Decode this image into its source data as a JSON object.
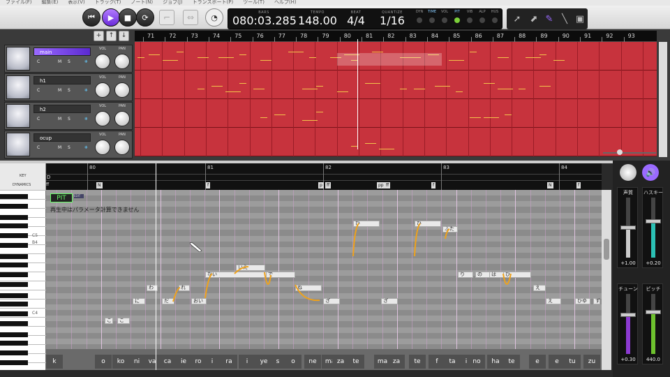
{
  "menu": [
    "ファイル(F)",
    "編集(E)",
    "表示(V)",
    "トラック(T)",
    "ノート(N)",
    "ジョブ(J)",
    "トランスポート(P)",
    "ツール(T)",
    "ヘルプ(H)"
  ],
  "transport": {
    "bars_label": "BARS",
    "bars_value": "080:03.285",
    "tempo_label": "TEMPO",
    "tempo_value": "148.00",
    "beat_label": "BEAT",
    "beat_value": "4/4",
    "quantize_label": "QUANTIZE",
    "quantize_value": "1/16"
  },
  "toggles": [
    "DYN",
    "TIME",
    "VOL",
    "PIT",
    "VIB",
    "ALP",
    "HUS"
  ],
  "toggle_on": "PIT",
  "track_ruler": [
    "71",
    "72",
    "73",
    "74",
    "75",
    "76",
    "77",
    "78",
    "79",
    "80",
    "81",
    "82",
    "83",
    "84",
    "85",
    "86",
    "87",
    "88",
    "89",
    "90",
    "91",
    "92",
    "93"
  ],
  "tracks": [
    {
      "name": "main",
      "selected": true
    },
    {
      "name": "h1",
      "selected": false
    },
    {
      "name": "h2",
      "selected": false
    },
    {
      "name": "ocup",
      "selected": false
    }
  ],
  "track_buttons": {
    "c": "C",
    "m": "M",
    "s": "S"
  },
  "knob_labels": {
    "vol": "VOL",
    "pan": "PAN"
  },
  "editor": {
    "key_label": "KEY",
    "dynamics_label": "DYNAMICS",
    "key_value": "D",
    "dyn_start": "ff",
    "bars": [
      "80",
      "81",
      "82",
      "83",
      "84"
    ],
    "dynamics": [
      "N",
      "f",
      "p",
      "ff",
      "pp",
      "ff",
      "f",
      "N",
      "f"
    ],
    "pit_label": "PIT",
    "pit_sub": "EDIT",
    "warning": "再生中はパラメータ計算できません",
    "octave_labels": [
      "C5",
      "B4",
      "C4"
    ]
  },
  "notes": [
    "ひ",
    "ひ",
    "ふた",
    "いえ",
    "ない",
    "で",
    "り",
    "の",
    "は",
    "ひ",
    "わ",
    "れ",
    "え",
    "ね",
    "に",
    "だ",
    "おい",
    "ざ",
    "ざ",
    "え",
    "ひゆ",
    "ず",
    "こ",
    "こ"
  ],
  "lyrics": [
    "k",
    "o",
    "ko",
    "ni",
    "va",
    "ca",
    "ie",
    "ro",
    "i",
    "ra",
    "i",
    "ye",
    "s",
    "o",
    "ne",
    "ma",
    "za",
    "te",
    "ma",
    "za",
    "te",
    "f",
    "ta",
    "i",
    "no",
    "ha",
    "te",
    "e",
    "e",
    "tu",
    "zu"
  ],
  "right_panel": {
    "sliders": [
      {
        "label": "声質",
        "value": "+1.00",
        "color": "#cccccc",
        "level": 0.5
      },
      {
        "label": "ハスキー",
        "value": "+0.20",
        "color": "#2bc0b4",
        "level": 0.6
      },
      {
        "label": "チューン",
        "value": "+0.30",
        "color": "#8c3ad1",
        "level": 0.65
      },
      {
        "label": "ピッチ",
        "value": "440.0",
        "color": "#6ec12e",
        "level": 0.7
      }
    ]
  }
}
